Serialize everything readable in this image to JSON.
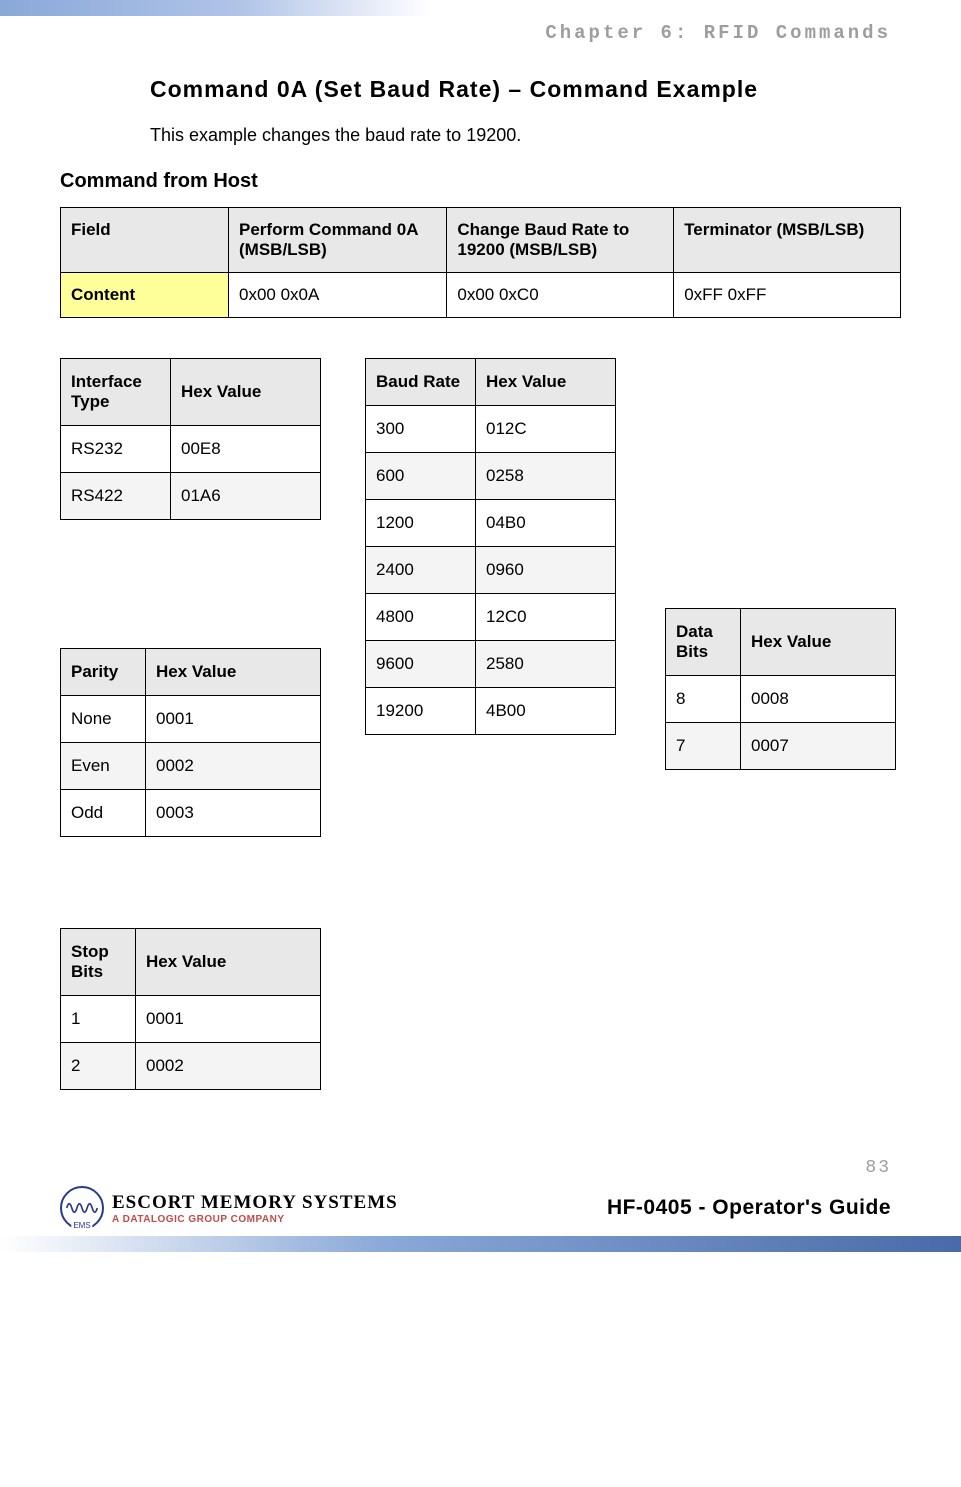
{
  "chapter": "Chapter 6: RFID Commands",
  "heading": "Command 0A (Set Baud Rate) – Command Example",
  "intro": "This example changes the baud rate to 19200.",
  "subhead_host": "Command from Host",
  "cmdtable": {
    "h1": "Field",
    "h2": "Perform Command 0A (MSB/LSB)",
    "h3": "Change Baud Rate to 19200 (MSB/LSB)",
    "h4": "Terminator (MSB/LSB)",
    "r1c1": "Content",
    "r1c2": "0x00 0x0A",
    "r1c3": "0x00 0xC0",
    "r1c4": "0xFF 0xFF"
  },
  "interface": {
    "h1": "Interface Type",
    "h2": "Hex Value",
    "rows": [
      {
        "a": "RS232",
        "b": "00E8"
      },
      {
        "a": "RS422",
        "b": "01A6"
      }
    ]
  },
  "baud": {
    "h1": "Baud Rate",
    "h2": "Hex Value",
    "rows": [
      {
        "a": "300",
        "b": "012C"
      },
      {
        "a": "600",
        "b": "0258"
      },
      {
        "a": "1200",
        "b": "04B0"
      },
      {
        "a": "2400",
        "b": "0960"
      },
      {
        "a": "4800",
        "b": "12C0"
      },
      {
        "a": "9600",
        "b": "2580"
      },
      {
        "a": "19200",
        "b": "4B00"
      }
    ]
  },
  "parity": {
    "h1": "Parity",
    "h2": "Hex Value",
    "rows": [
      {
        "a": "None",
        "b": "0001"
      },
      {
        "a": "Even",
        "b": "0002"
      },
      {
        "a": "Odd",
        "b": "0003"
      }
    ]
  },
  "databits": {
    "h1": "Data Bits",
    "h2": "Hex Value",
    "rows": [
      {
        "a": "8",
        "b": "0008"
      },
      {
        "a": "7",
        "b": "0007"
      }
    ]
  },
  "stopbits": {
    "h1": "Stop Bits",
    "h2": "Hex Value",
    "rows": [
      {
        "a": "1",
        "b": "0001"
      },
      {
        "a": "2",
        "b": "0002"
      }
    ]
  },
  "page_number": "83",
  "logo_company": "ESCORT MEMORY SYSTEMS",
  "logo_sub": "A DATALOGIC GROUP COMPANY",
  "logo_badge": "EMS",
  "guide_title": "HF-0405 - Operator's Guide"
}
